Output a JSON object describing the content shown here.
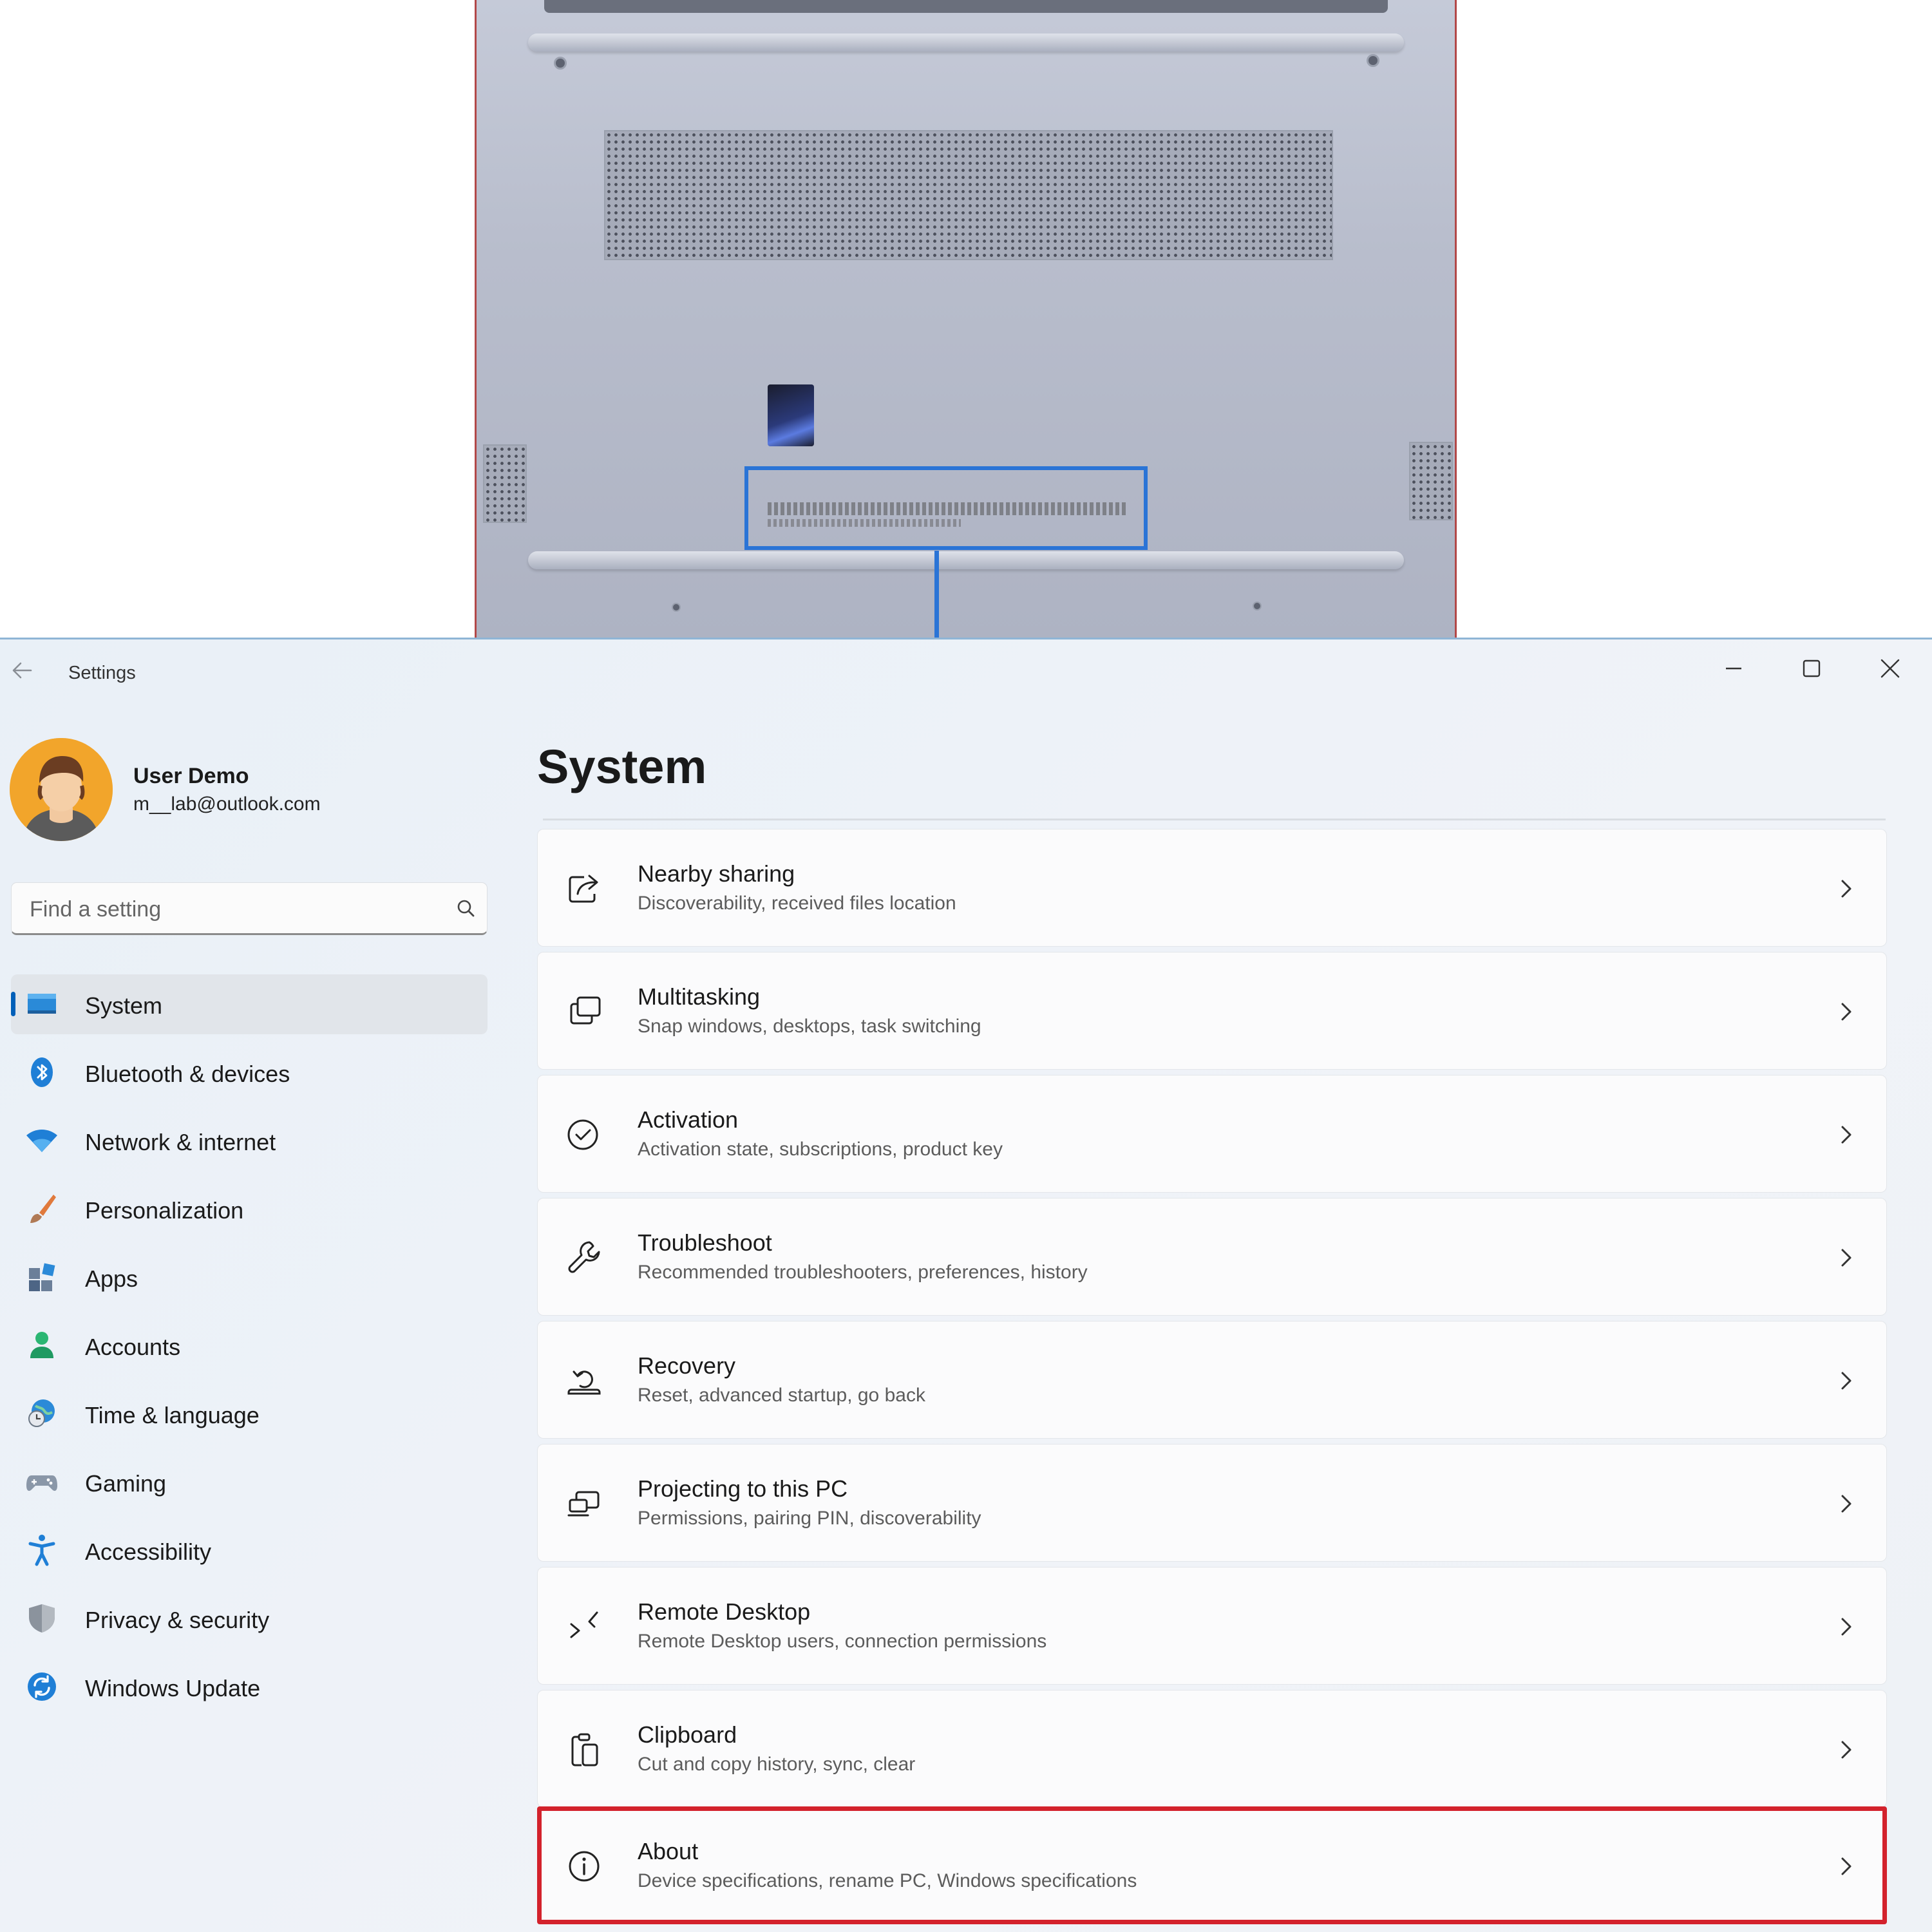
{
  "window": {
    "app_title": "Settings",
    "controls": {
      "minimize": "minimize-icon",
      "maximize": "maximize-icon",
      "close": "close-icon"
    }
  },
  "user": {
    "name": "User Demo",
    "email": "m__lab@outlook.com"
  },
  "search": {
    "placeholder": "Find a setting",
    "value": ""
  },
  "sidebar": {
    "selected": "System",
    "items": [
      {
        "label": "System",
        "icon": "monitor-icon"
      },
      {
        "label": "Bluetooth & devices",
        "icon": "bluetooth-icon"
      },
      {
        "label": "Network & internet",
        "icon": "wifi-icon"
      },
      {
        "label": "Personalization",
        "icon": "paintbrush-icon"
      },
      {
        "label": "Apps",
        "icon": "apps-icon"
      },
      {
        "label": "Accounts",
        "icon": "person-icon"
      },
      {
        "label": "Time & language",
        "icon": "globe-clock-icon"
      },
      {
        "label": "Gaming",
        "icon": "gamepad-icon"
      },
      {
        "label": "Accessibility",
        "icon": "accessibility-icon"
      },
      {
        "label": "Privacy & security",
        "icon": "shield-icon"
      },
      {
        "label": "Windows Update",
        "icon": "update-icon"
      }
    ]
  },
  "main": {
    "title": "System",
    "items": [
      {
        "title": "Nearby sharing",
        "subtitle": "Discoverability, received files location",
        "icon": "share-icon"
      },
      {
        "title": "Multitasking",
        "subtitle": "Snap windows, desktops, task switching",
        "icon": "multitasking-icon"
      },
      {
        "title": "Activation",
        "subtitle": "Activation state, subscriptions, product key",
        "icon": "check-circle-icon"
      },
      {
        "title": "Troubleshoot",
        "subtitle": "Recommended troubleshooters, preferences, history",
        "icon": "wrench-icon"
      },
      {
        "title": "Recovery",
        "subtitle": "Reset, advanced startup, go back",
        "icon": "recovery-icon"
      },
      {
        "title": "Projecting to this PC",
        "subtitle": "Permissions, pairing PIN, discoverability",
        "icon": "projecting-icon"
      },
      {
        "title": "Remote Desktop",
        "subtitle": "Remote Desktop users, connection permissions",
        "icon": "remote-desktop-icon"
      },
      {
        "title": "Clipboard",
        "subtitle": "Cut and copy history, sync, clear",
        "icon": "clipboard-icon"
      },
      {
        "title": "About",
        "subtitle": "Device specifications, rename PC, Windows specifications",
        "icon": "info-icon",
        "highlighted": true
      }
    ]
  },
  "colors": {
    "accent": "#005fb8",
    "highlight_box": "#d3222c",
    "label_callout": "#2a74d6"
  }
}
